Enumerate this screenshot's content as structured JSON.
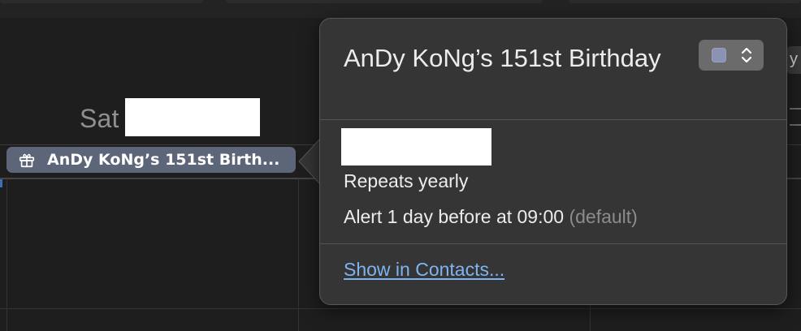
{
  "calendar": {
    "day_label": "Sat",
    "event_pill_label": "AnDy KoNg’s 151st Birth...",
    "event_icon": "gift-icon",
    "event_color": "#5d6578",
    "edge_button_glyph": "y"
  },
  "popover": {
    "title": "AnDy KoNg’s 151st Birthday",
    "calendar_picker": {
      "swatch_color": "#8a93b3",
      "icon": "up-down-chevron-icon"
    },
    "repeat_text": "Repeats yearly",
    "alert_text": "Alert 1 day before at 09:00",
    "alert_suffix": "(default)",
    "contacts_link": "Show in Contacts..."
  },
  "colors": {
    "background": "#1e1e1e",
    "popover_bg": "#353535",
    "link": "#7fb4f0"
  }
}
